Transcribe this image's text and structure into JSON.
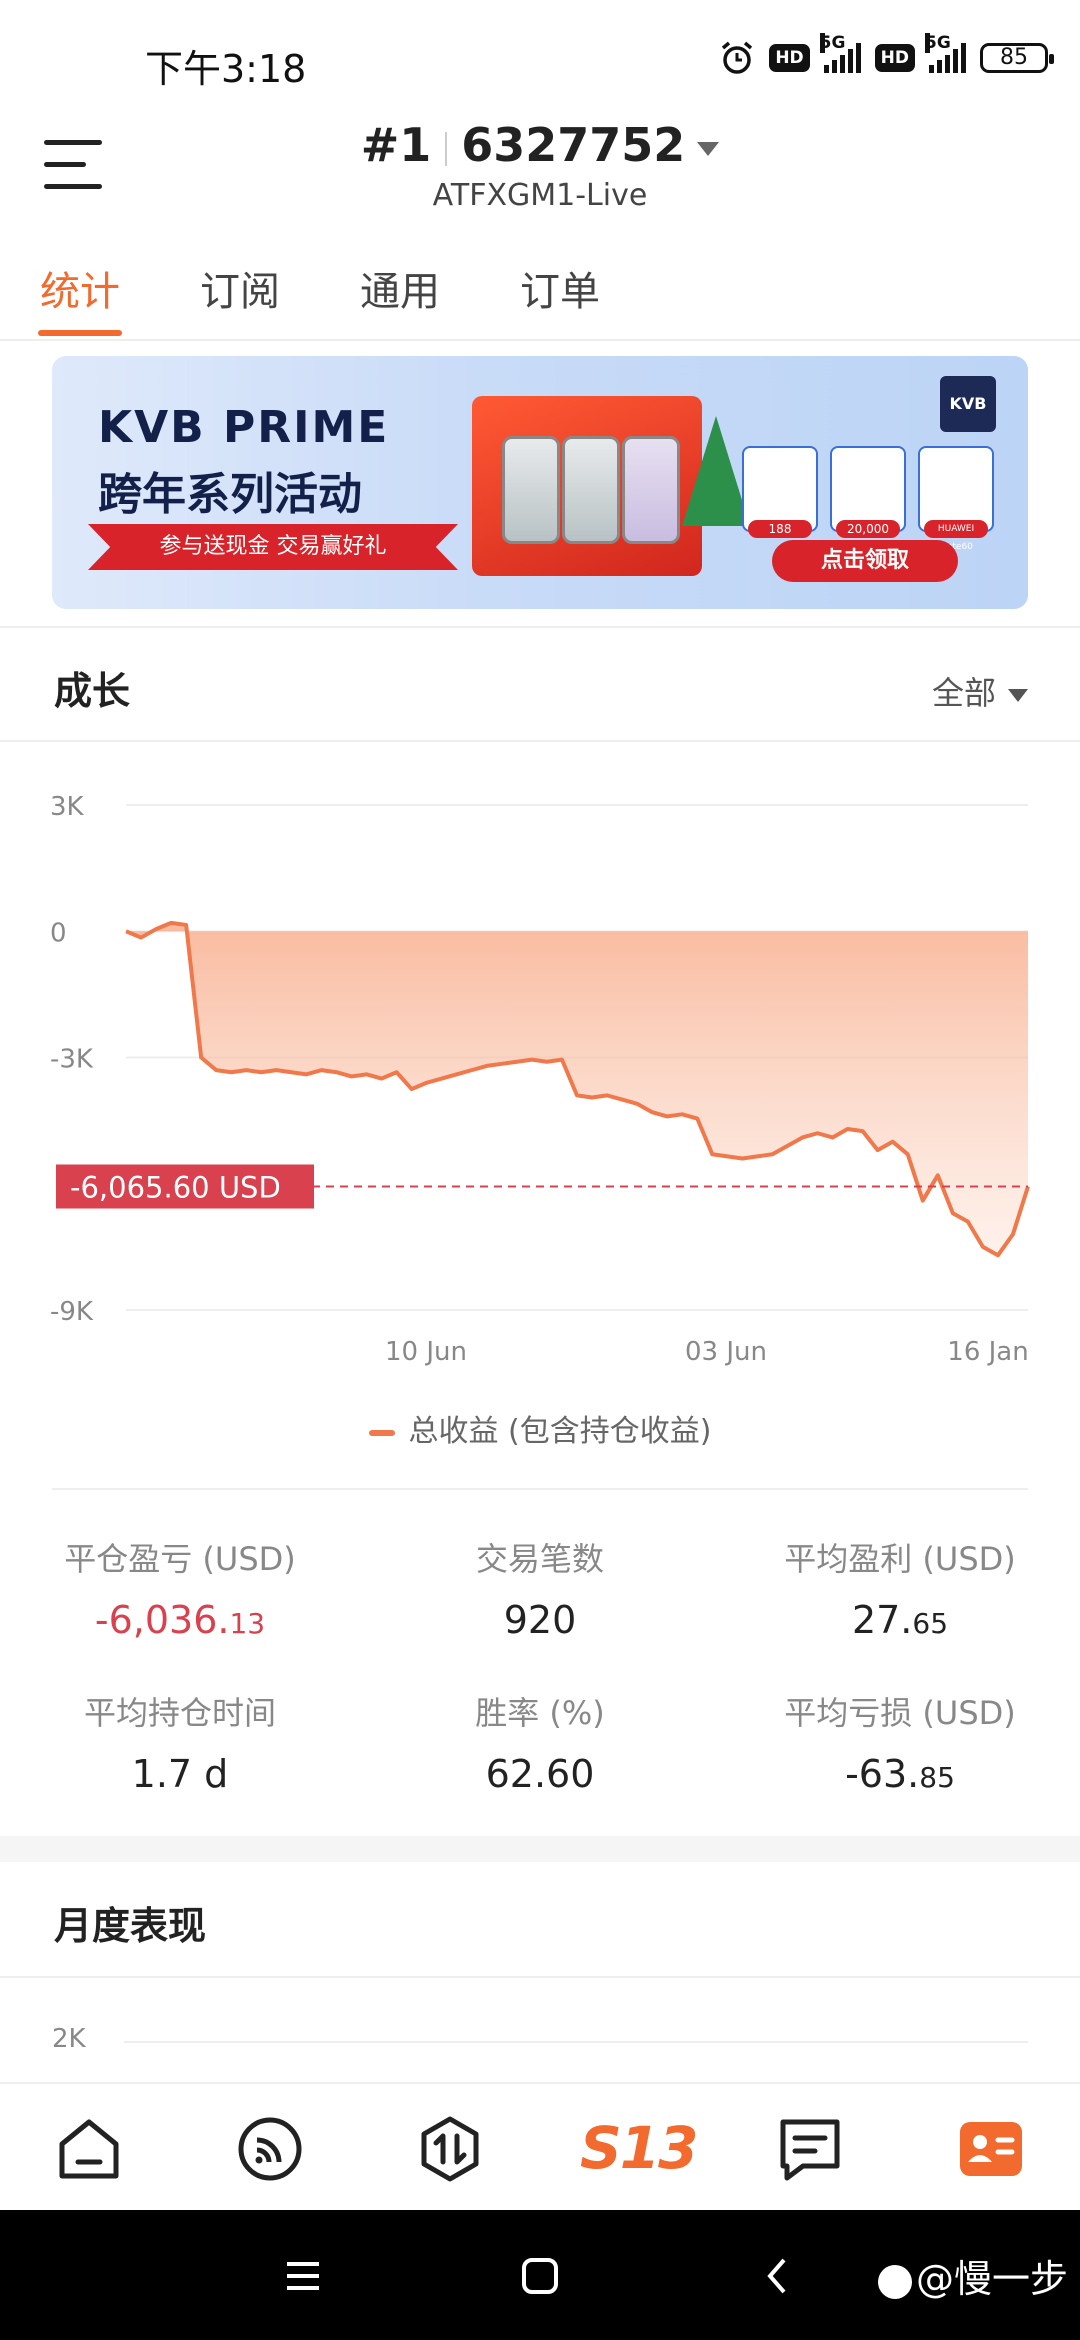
{
  "status_bar": {
    "time": "下午3:18",
    "net1": "5G",
    "net2": "5G",
    "hd": "HD",
    "battery": "85"
  },
  "header": {
    "account_no": "#1",
    "account_id": "6327752",
    "server": "ATFXGM1-Live"
  },
  "tabs": [
    {
      "label": "统计"
    },
    {
      "label": "订阅"
    },
    {
      "label": "通用"
    },
    {
      "label": "订单"
    }
  ],
  "banner": {
    "brand": "KVB PRIME",
    "subtitle": "跨年系列活动",
    "ribbon": "参与送现金 交易赢好礼",
    "cta": "点击领取",
    "logo": "KVB",
    "prizes": [
      "188",
      "20,000",
      "HUAWEI Mate60"
    ]
  },
  "growth": {
    "title": "成长",
    "filter": "全部"
  },
  "chart_data": {
    "type": "area",
    "y_ticks": [
      "3K",
      "0",
      "-3K",
      "-9K"
    ],
    "x_ticks": [
      "10 Jun",
      "03 Jun",
      "16 Jan"
    ],
    "ylim": [
      -9000,
      3000
    ],
    "current_label": "-6,065.60 USD",
    "current_value": -6065.6,
    "series": [
      {
        "name": "总收益 (包含持仓收益)",
        "color": "#f0784a",
        "values": [
          0,
          -150,
          50,
          200,
          150,
          -3000,
          -3300,
          -3350,
          -3300,
          -3350,
          -3300,
          -3350,
          -3400,
          -3300,
          -3350,
          -3450,
          -3400,
          -3500,
          -3350,
          -3750,
          -3600,
          -3500,
          -3400,
          -3300,
          -3200,
          -3150,
          -3100,
          -3050,
          -3100,
          -3050,
          -3900,
          -3950,
          -3900,
          -4000,
          -4100,
          -4300,
          -4400,
          -4350,
          -4450,
          -5300,
          -5350,
          -5400,
          -5350,
          -5300,
          -5100,
          -4900,
          -4800,
          -4900,
          -4700,
          -4750,
          -5200,
          -5000,
          -5300,
          -6400,
          -5800,
          -6700,
          -6900,
          -7500,
          -7700,
          -7200,
          -6065
        ]
      }
    ]
  },
  "stats": [
    {
      "label": "平仓盈亏 (USD)",
      "value": "-6,036.",
      "decimals": "13"
    },
    {
      "label": "交易笔数",
      "value": "920",
      "decimals": ""
    },
    {
      "label": "平均盈利 (USD)",
      "value": "27.",
      "decimals": "65"
    },
    {
      "label": "平均持仓时间",
      "value": "1.7 d",
      "decimals": ""
    },
    {
      "label": "胜率 (%)",
      "value": "62.60",
      "decimals": ""
    },
    {
      "label": "平均亏损 (USD)",
      "value": "-63.",
      "decimals": "85"
    }
  ],
  "monthly": {
    "title": "月度表现",
    "y_tick": "2K"
  },
  "bottom_nav": {
    "s13": "S13"
  },
  "watermark": "@慢一步"
}
